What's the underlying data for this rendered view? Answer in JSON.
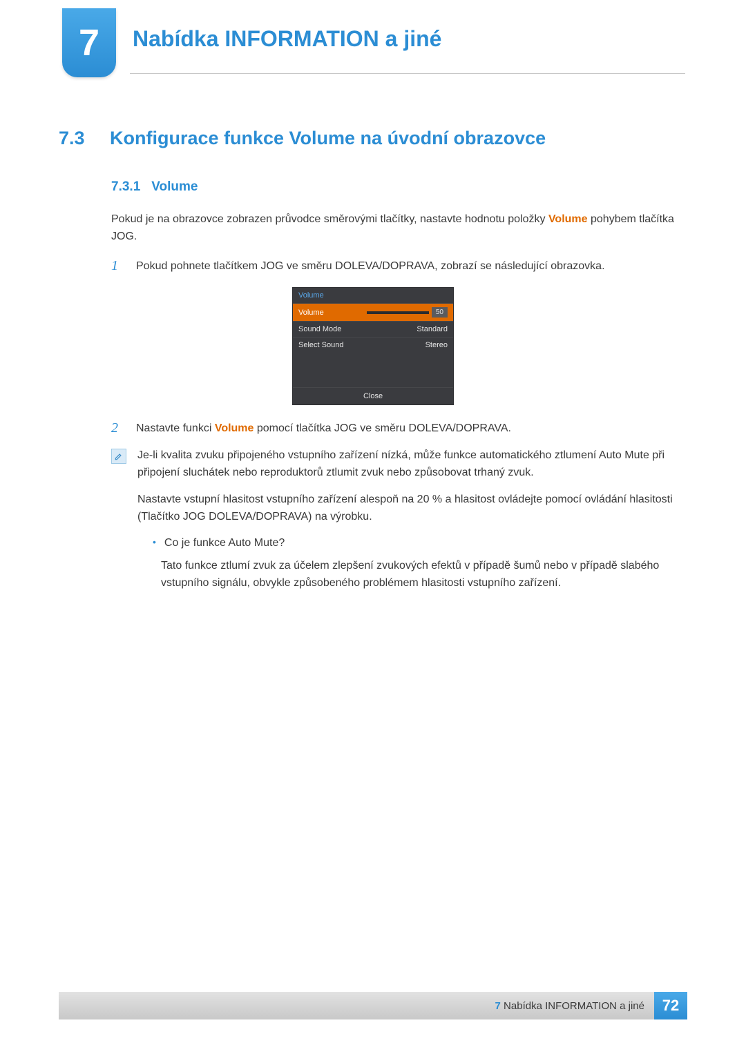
{
  "chapter": {
    "number": "7",
    "title": "Nabídka INFORMATION a jiné"
  },
  "section": {
    "number": "7.3",
    "title": "Konfigurace funkce Volume na úvodní obrazovce"
  },
  "subsection": {
    "number": "7.3.1",
    "title": "Volume"
  },
  "intro": {
    "part1": "Pokud je na obrazovce zobrazen průvodce směrovými tlačítky, nastavte hodnotu položky ",
    "volume_kw": "Volume",
    "part2": " pohybem tlačítka JOG."
  },
  "steps": {
    "s1": {
      "num": "1",
      "text": "Pokud pohnete tlačítkem JOG ve směru DOLEVA/DOPRAVA, zobrazí se následující obrazovka."
    },
    "s2": {
      "num": "2",
      "pre": "Nastavte funkci ",
      "kw": "Volume",
      "post": " pomocí tlačítka JOG ve směru DOLEVA/DOPRAVA."
    }
  },
  "osd": {
    "header": "Volume",
    "rows": {
      "volume": {
        "label": "Volume",
        "value": "50"
      },
      "sound_mode": {
        "label": "Sound Mode",
        "value": "Standard"
      },
      "select_sound": {
        "label": "Select Sound",
        "value": "Stereo"
      }
    },
    "close": "Close"
  },
  "note": {
    "p1": "Je-li kvalita zvuku připojeného vstupního zařízení nízká, může funkce automatického ztlumení Auto Mute při připojení sluchátek nebo reproduktorů ztlumit zvuk nebo způsobovat trhaný zvuk.",
    "p2": "Nastavte vstupní hlasitost vstupního zařízení alespoň na 20 % a hlasitost ovládejte pomocí ovládání hlasitosti (Tlačítko JOG DOLEVA/DOPRAVA) na výrobku.",
    "bullet": {
      "q": "Co je funkce Auto Mute?",
      "a": "Tato funkce ztlumí zvuk za účelem zlepšení zvukových efektů v případě šumů nebo v případě slabého vstupního signálu, obvykle způsobeného problémem hlasitosti vstupního zařízení."
    }
  },
  "footer": {
    "chapter_num": "7",
    "chapter_title": "Nabídka INFORMATION a jiné",
    "page": "72"
  }
}
